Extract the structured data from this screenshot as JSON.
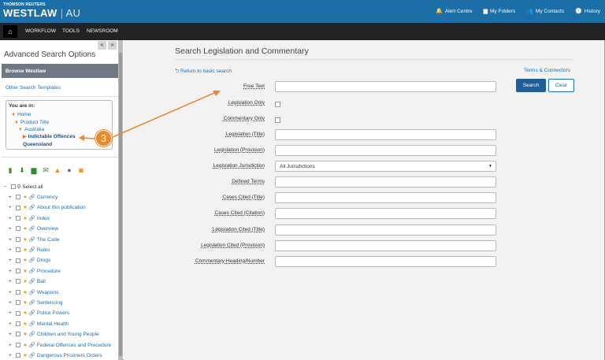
{
  "topbar": {
    "brand_small": "THOMSON REUTERS",
    "brand_big": "WESTLAW",
    "brand_region": "AU",
    "links": [
      {
        "icon": "bell-icon",
        "glyph": "🔔",
        "label": "Alert Centre"
      },
      {
        "icon": "folder-icon",
        "glyph": "▆",
        "label": "My Folders"
      },
      {
        "icon": "contacts-icon",
        "glyph": "👥",
        "label": "My Contacts"
      },
      {
        "icon": "clock-icon",
        "glyph": "🕓",
        "label": "History"
      }
    ]
  },
  "darknav": {
    "home_glyph": "⌂",
    "items": [
      "WORKFLOW",
      "TOOLS",
      "NEWSROOM"
    ]
  },
  "leftpanel": {
    "collapse_left": "«",
    "collapse_right": "»",
    "title": "Advanced Search Options",
    "browse": "Browse Westlaw",
    "other_templates": "Other Search Templates",
    "you_are_in": "You are in:",
    "breadcrumbs": [
      "Home",
      "Product Title",
      "Australia",
      "Indictable Offences",
      "Queensland"
    ],
    "select_all": "Select all",
    "tree": [
      "Currency",
      "About this publication",
      "Index",
      "Overview",
      "The Code",
      "Rules",
      "Drugs",
      "Procedure",
      "Bail",
      "Weapons",
      "Sentencing",
      "Police Powers",
      "Mental Health",
      "Children and Young People",
      "Federal Offences and Procedure",
      "Dangerous Prisoners Orders"
    ]
  },
  "main": {
    "title": "Search Legislation and Commentary",
    "return_link": "Return to basic search",
    "terms_link": "Terms & Connectors",
    "search_button": "Search",
    "clear_button": "Clear",
    "fields": [
      {
        "label": "Free Text",
        "type": "text",
        "value": ""
      },
      {
        "label": "Legislation Only",
        "type": "checkbox"
      },
      {
        "label": "Commentary Only",
        "type": "checkbox"
      },
      {
        "label": "Legislation (Title)",
        "type": "text",
        "value": ""
      },
      {
        "label": "Legislation (Provision)",
        "type": "text",
        "value": ""
      },
      {
        "label": "Legislation Jurisdiction",
        "type": "select",
        "value": "All Jurisdictions"
      },
      {
        "label": "Defined Terms",
        "type": "text",
        "value": ""
      },
      {
        "label": "Cases Cited (Title)",
        "type": "text",
        "value": ""
      },
      {
        "label": "Cases Cited (Citation)",
        "type": "text",
        "value": ""
      },
      {
        "label": "Legislation Cited (Title)",
        "type": "text",
        "value": ""
      },
      {
        "label": "Legislation Cited (Provision)",
        "type": "text",
        "value": ""
      },
      {
        "label": "Commentary Heading/Number",
        "type": "text",
        "value": ""
      }
    ]
  },
  "callout": {
    "number": "3",
    "color": "#e68a2e"
  },
  "colors": {
    "brand_blue": "#1b6fa6",
    "dark_nav": "#222222",
    "link": "#1a6fb0",
    "search_button": "#1f5f96"
  }
}
